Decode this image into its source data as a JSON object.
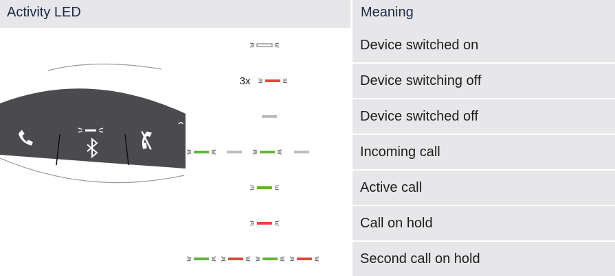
{
  "header": {
    "left_title": "Activity LED",
    "right_title": "Meaning"
  },
  "colors": {
    "header_bg": "#e7e7e9",
    "meaning_bg": "#e7e7e9",
    "green": "#5fb53a",
    "red": "#e6433d",
    "gray": "#bdbdbd",
    "white_led": "#ffffff",
    "device_body": "#4b4b4f"
  },
  "rows": [
    {
      "led_prefix": "",
      "led_pattern": "white-blink",
      "meaning": "Device switched on"
    },
    {
      "led_prefix": "3x",
      "led_pattern": "red-blink",
      "meaning": "Device switching off"
    },
    {
      "led_prefix": "",
      "led_pattern": "gray-steady",
      "meaning": "Device switched off"
    },
    {
      "led_prefix": "",
      "led_pattern": "green-blink-alternating",
      "meaning": "Incoming call"
    },
    {
      "led_prefix": "",
      "led_pattern": "green-blink",
      "meaning": "Active call"
    },
    {
      "led_prefix": "",
      "led_pattern": "red-blink",
      "meaning": "Call on hold"
    },
    {
      "led_prefix": "",
      "led_pattern": "green-red-alternating",
      "meaning": "Second call on hold"
    }
  ],
  "device": {
    "icons": [
      "phone-answer-icon",
      "bluetooth-icon",
      "phone-hangup-icon"
    ],
    "led_indicator": "white-blink"
  }
}
